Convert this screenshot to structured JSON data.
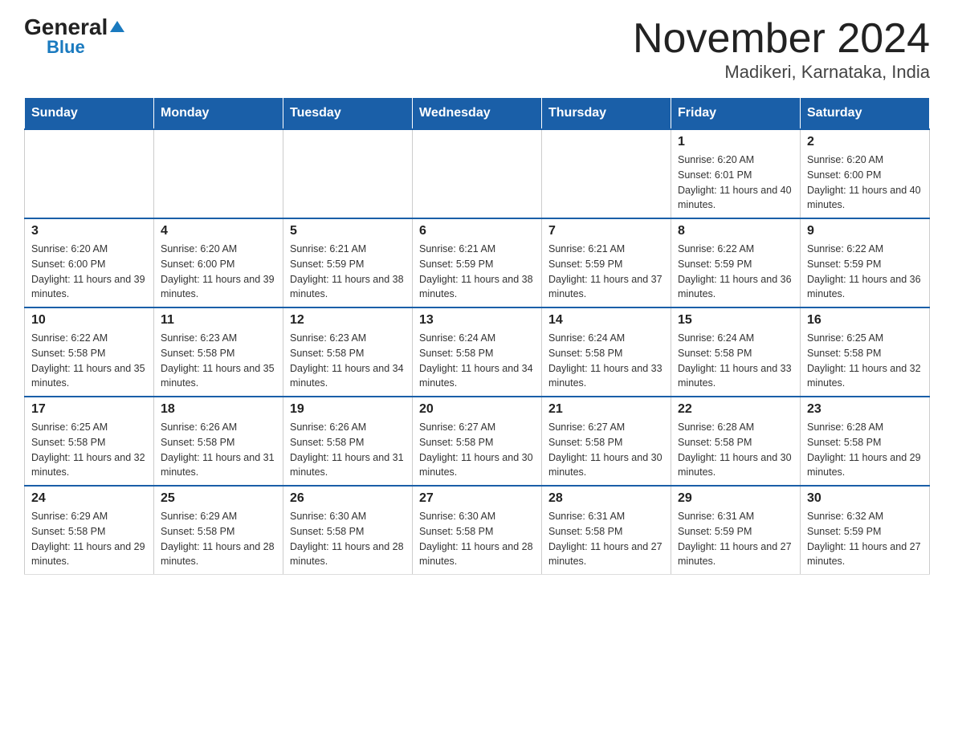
{
  "logo": {
    "general": "General",
    "triangle": "▶",
    "blue": "Blue"
  },
  "title": {
    "month_year": "November 2024",
    "location": "Madikeri, Karnataka, India"
  },
  "days_of_week": [
    "Sunday",
    "Monday",
    "Tuesday",
    "Wednesday",
    "Thursday",
    "Friday",
    "Saturday"
  ],
  "weeks": [
    [
      {
        "day": "",
        "info": ""
      },
      {
        "day": "",
        "info": ""
      },
      {
        "day": "",
        "info": ""
      },
      {
        "day": "",
        "info": ""
      },
      {
        "day": "",
        "info": ""
      },
      {
        "day": "1",
        "info": "Sunrise: 6:20 AM\nSunset: 6:01 PM\nDaylight: 11 hours and 40 minutes."
      },
      {
        "day": "2",
        "info": "Sunrise: 6:20 AM\nSunset: 6:00 PM\nDaylight: 11 hours and 40 minutes."
      }
    ],
    [
      {
        "day": "3",
        "info": "Sunrise: 6:20 AM\nSunset: 6:00 PM\nDaylight: 11 hours and 39 minutes."
      },
      {
        "day": "4",
        "info": "Sunrise: 6:20 AM\nSunset: 6:00 PM\nDaylight: 11 hours and 39 minutes."
      },
      {
        "day": "5",
        "info": "Sunrise: 6:21 AM\nSunset: 5:59 PM\nDaylight: 11 hours and 38 minutes."
      },
      {
        "day": "6",
        "info": "Sunrise: 6:21 AM\nSunset: 5:59 PM\nDaylight: 11 hours and 38 minutes."
      },
      {
        "day": "7",
        "info": "Sunrise: 6:21 AM\nSunset: 5:59 PM\nDaylight: 11 hours and 37 minutes."
      },
      {
        "day": "8",
        "info": "Sunrise: 6:22 AM\nSunset: 5:59 PM\nDaylight: 11 hours and 36 minutes."
      },
      {
        "day": "9",
        "info": "Sunrise: 6:22 AM\nSunset: 5:59 PM\nDaylight: 11 hours and 36 minutes."
      }
    ],
    [
      {
        "day": "10",
        "info": "Sunrise: 6:22 AM\nSunset: 5:58 PM\nDaylight: 11 hours and 35 minutes."
      },
      {
        "day": "11",
        "info": "Sunrise: 6:23 AM\nSunset: 5:58 PM\nDaylight: 11 hours and 35 minutes."
      },
      {
        "day": "12",
        "info": "Sunrise: 6:23 AM\nSunset: 5:58 PM\nDaylight: 11 hours and 34 minutes."
      },
      {
        "day": "13",
        "info": "Sunrise: 6:24 AM\nSunset: 5:58 PM\nDaylight: 11 hours and 34 minutes."
      },
      {
        "day": "14",
        "info": "Sunrise: 6:24 AM\nSunset: 5:58 PM\nDaylight: 11 hours and 33 minutes."
      },
      {
        "day": "15",
        "info": "Sunrise: 6:24 AM\nSunset: 5:58 PM\nDaylight: 11 hours and 33 minutes."
      },
      {
        "day": "16",
        "info": "Sunrise: 6:25 AM\nSunset: 5:58 PM\nDaylight: 11 hours and 32 minutes."
      }
    ],
    [
      {
        "day": "17",
        "info": "Sunrise: 6:25 AM\nSunset: 5:58 PM\nDaylight: 11 hours and 32 minutes."
      },
      {
        "day": "18",
        "info": "Sunrise: 6:26 AM\nSunset: 5:58 PM\nDaylight: 11 hours and 31 minutes."
      },
      {
        "day": "19",
        "info": "Sunrise: 6:26 AM\nSunset: 5:58 PM\nDaylight: 11 hours and 31 minutes."
      },
      {
        "day": "20",
        "info": "Sunrise: 6:27 AM\nSunset: 5:58 PM\nDaylight: 11 hours and 30 minutes."
      },
      {
        "day": "21",
        "info": "Sunrise: 6:27 AM\nSunset: 5:58 PM\nDaylight: 11 hours and 30 minutes."
      },
      {
        "day": "22",
        "info": "Sunrise: 6:28 AM\nSunset: 5:58 PM\nDaylight: 11 hours and 30 minutes."
      },
      {
        "day": "23",
        "info": "Sunrise: 6:28 AM\nSunset: 5:58 PM\nDaylight: 11 hours and 29 minutes."
      }
    ],
    [
      {
        "day": "24",
        "info": "Sunrise: 6:29 AM\nSunset: 5:58 PM\nDaylight: 11 hours and 29 minutes."
      },
      {
        "day": "25",
        "info": "Sunrise: 6:29 AM\nSunset: 5:58 PM\nDaylight: 11 hours and 28 minutes."
      },
      {
        "day": "26",
        "info": "Sunrise: 6:30 AM\nSunset: 5:58 PM\nDaylight: 11 hours and 28 minutes."
      },
      {
        "day": "27",
        "info": "Sunrise: 6:30 AM\nSunset: 5:58 PM\nDaylight: 11 hours and 28 minutes."
      },
      {
        "day": "28",
        "info": "Sunrise: 6:31 AM\nSunset: 5:58 PM\nDaylight: 11 hours and 27 minutes."
      },
      {
        "day": "29",
        "info": "Sunrise: 6:31 AM\nSunset: 5:59 PM\nDaylight: 11 hours and 27 minutes."
      },
      {
        "day": "30",
        "info": "Sunrise: 6:32 AM\nSunset: 5:59 PM\nDaylight: 11 hours and 27 minutes."
      }
    ]
  ]
}
